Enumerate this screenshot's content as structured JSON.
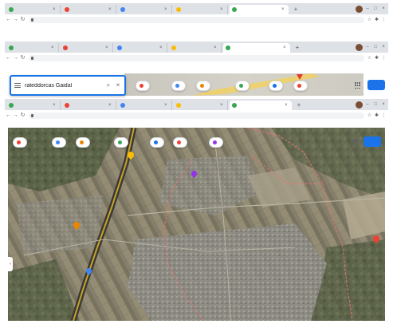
{
  "frames": [
    {
      "tabs": [
        {
          "label": "",
          "color": "#34a853"
        },
        {
          "label": "",
          "color": "#ea4335"
        },
        {
          "label": "",
          "color": "#4285f4"
        },
        {
          "label": "",
          "color": "#fbbc04"
        },
        {
          "label": "",
          "color": "#34a853",
          "active": true
        }
      ],
      "url": ""
    },
    {
      "tabs": [
        {
          "label": "",
          "color": "#34a853"
        },
        {
          "label": "",
          "color": "#ea4335"
        },
        {
          "label": "",
          "color": "#4285f4"
        },
        {
          "label": "",
          "color": "#fbbc04"
        },
        {
          "label": "",
          "color": "#34a853",
          "active": true
        }
      ],
      "url": ""
    },
    {
      "tabs": [
        {
          "label": "",
          "color": "#34a853"
        },
        {
          "label": "",
          "color": "#ea4335"
        },
        {
          "label": "",
          "color": "#4285f4"
        },
        {
          "label": "",
          "color": "#fbbc04"
        },
        {
          "label": "",
          "color": "#34a853",
          "active": true
        }
      ],
      "url": ""
    }
  ],
  "search": {
    "query": "rateddorcas Gaidal"
  },
  "chips": [
    {
      "label": "",
      "color": "#ea4335"
    },
    {
      "label": "",
      "color": "#4285f4"
    },
    {
      "label": "",
      "color": "#ea8600"
    },
    {
      "label": "",
      "color": "#34a853"
    },
    {
      "label": "",
      "color": "#1a73e8"
    },
    {
      "label": "",
      "color": "#ea4335"
    }
  ],
  "sign_in_label": "",
  "map_chips": [
    {
      "label": "",
      "color": "#ea4335"
    },
    {
      "label": "",
      "color": "#4285f4"
    },
    {
      "label": "",
      "color": "#ea8600"
    },
    {
      "label": "",
      "color": "#34a853"
    },
    {
      "label": "",
      "color": "#1a73e8"
    },
    {
      "label": "",
      "color": "#ea4335"
    },
    {
      "label": "",
      "color": "#9334e6"
    }
  ],
  "colors": {
    "accent": "#1a73e8",
    "boundary": "#e57373",
    "road": "#c9a227"
  }
}
